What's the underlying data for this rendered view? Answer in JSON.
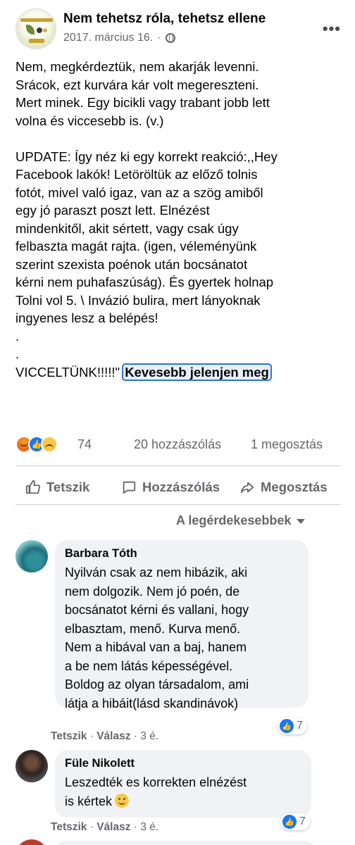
{
  "post": {
    "page_name": "Nem tehetsz róla, tehetsz ellene",
    "date": "2017. március 16.",
    "separator": "·",
    "more_label": "•••",
    "text": "Nem, megkérdeztük, nem akarják levenni.\nSrácok, ezt kurvára kár volt megereszteni.\nMert minek. Egy bicikli vagy trabant jobb lett\nvolna és viccesebb is. (v.)\n\nUPDATE: Így néz ki egy korrekt reakció:,,Hey\nFacebook lakók! Letöröltük az előző tolnis\nfotót, mivel való igaz, van az a szög amiből\negy jó paraszt poszt lett. Elnézést\nmindenkitől, akit sértett, vagy csak úgy\nfelbaszta magát rajta. (igen, véleményünk\nszerint szexista poénok után bocsánatot\nkérni nem puhafaszúság). És gyertek holnap\nTolni vol 5. \\ Invázió bulira, mert lányoknak\ningyenes lesz a belépés!\n.\n.\nVICCELTÜNK!!!!!\"",
    "see_less_label": "Kevesebb jelenjen meg"
  },
  "stats": {
    "reaction_count": "74",
    "comments": "20 hozzászólás",
    "shares": "1 megosztás"
  },
  "actions": {
    "like": "Tetszik",
    "comment": "Hozzászólás",
    "share": "Megosztás"
  },
  "sort": {
    "label": "A legérdekesebbek"
  },
  "comments": [
    {
      "author": "Barbara Tóth",
      "text": "Nyilván csak az nem hibázik, aki\nnem dolgozik. Nem jó poén, de\nbocsánatot kérni és vallani, hogy\nelbasztam, menő. Kurva menő.\nNem a hibával van a baj, hanem\na be nem látás képességével.\nBoldog az olyan társadalom, ami\nlátja a hibáit(lásd skandinávok)",
      "reaction_count": "7",
      "like_label": "Tetszik",
      "reply_label": "Válasz",
      "time": "3 é."
    },
    {
      "author": "Füle Nikolett",
      "text": "Leszedték es korrekten elnézést\nis kértek",
      "reaction_count": "7",
      "like_label": "Tetszik",
      "reply_label": "Válasz",
      "time": "3 é."
    }
  ],
  "colors": {
    "accent": "#1877f2",
    "secondary_text": "#65676b",
    "bubble": "#f0f2f5"
  }
}
